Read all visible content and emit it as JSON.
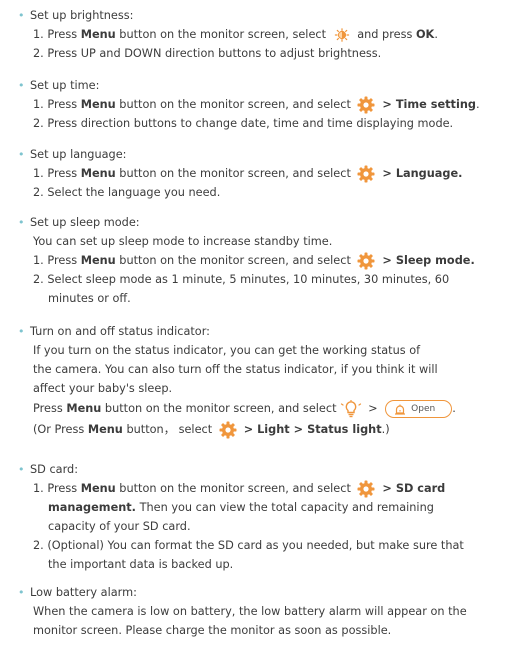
{
  "brightness": {
    "title": "Set up brightness:",
    "s1_pre": "1. Press ",
    "menu": "Menu",
    "s1_mid": " button on the monitor screen, select ",
    "s1_post": " and press ",
    "ok": "OK",
    "s1_end": ".",
    "s2": "2. Press UP and DOWN direction buttons to adjust brightness."
  },
  "time": {
    "title": "Set up time:",
    "s1_pre": "1. Press ",
    "menu": "Menu",
    "s1_mid": " button on the monitor screen, and select ",
    "sep": " > ",
    "target": "Time setting",
    "end": ".",
    "s2": "2. Press direction buttons to change date, time and time displaying mode."
  },
  "language": {
    "title": "Set up language:",
    "s1_pre": "1. Press ",
    "menu": "Menu",
    "s1_mid": " button on the monitor screen, and select ",
    "sep": " > ",
    "target": "Language.",
    "s2": "2. Select the language you need."
  },
  "sleep": {
    "title": "Set up sleep mode:",
    "intro": "You can set up sleep mode to increase standby time.",
    "s1_pre": "1. Press ",
    "menu": "Menu",
    "s1_mid": " button on the monitor screen, and select ",
    "sep": " > ",
    "target": "Sleep mode.",
    "s2a": "2. Select sleep mode as 1 minute, 5 minutes, 10 minutes, 30 minutes, 60",
    "s2b": "minutes or off."
  },
  "status": {
    "title": "Turn on and off status indicator:",
    "p1": "If you turn on the status indicator, you can get the working status of",
    "p2": "the camera. You can also turn off the status indicator, if you think it will",
    "p3": "affect your baby's sleep.",
    "press": "Press ",
    "menu": "Menu",
    "mid": " button on the monitor screen, and select",
    "gt": " > ",
    "open": "Open",
    "end": ".",
    "alt_pre": "(Or Press ",
    "alt_mid": " button， select ",
    "alt_sep1": " > ",
    "light": "Light",
    "alt_sep2": " > ",
    "status_light": "Status light",
    "alt_end": ".)"
  },
  "sd": {
    "title": "SD card:",
    "s1_pre": "1. Press ",
    "menu": "Menu",
    "s1_mid": " button on the monitor screen, and select ",
    "sep": " > ",
    "target1": "SD card",
    "target2": "management.",
    "l2": " Then you can view the total capacity and remaining",
    "l3": "capacity of your SD card.",
    "s2a": "2. (Optional) You can format the SD card as you needed, but make sure that",
    "s2b": "the important data is backed up."
  },
  "battery": {
    "title": "Low battery alarm:",
    "p1": "When the camera is low on battery, the low battery alarm will appear on the",
    "p2": "monitor screen. Please charge the monitor as soon as possible."
  },
  "icons": {
    "bullet": "•",
    "brightness": "brightness-icon",
    "settings": "settings-gear-icon",
    "bulb": "light-bulb-icon",
    "lamp": "status-lamp-icon"
  },
  "colors": {
    "accent": "#f0963c",
    "bullet": "#7ec4cf",
    "text": "#3c3c3c"
  }
}
